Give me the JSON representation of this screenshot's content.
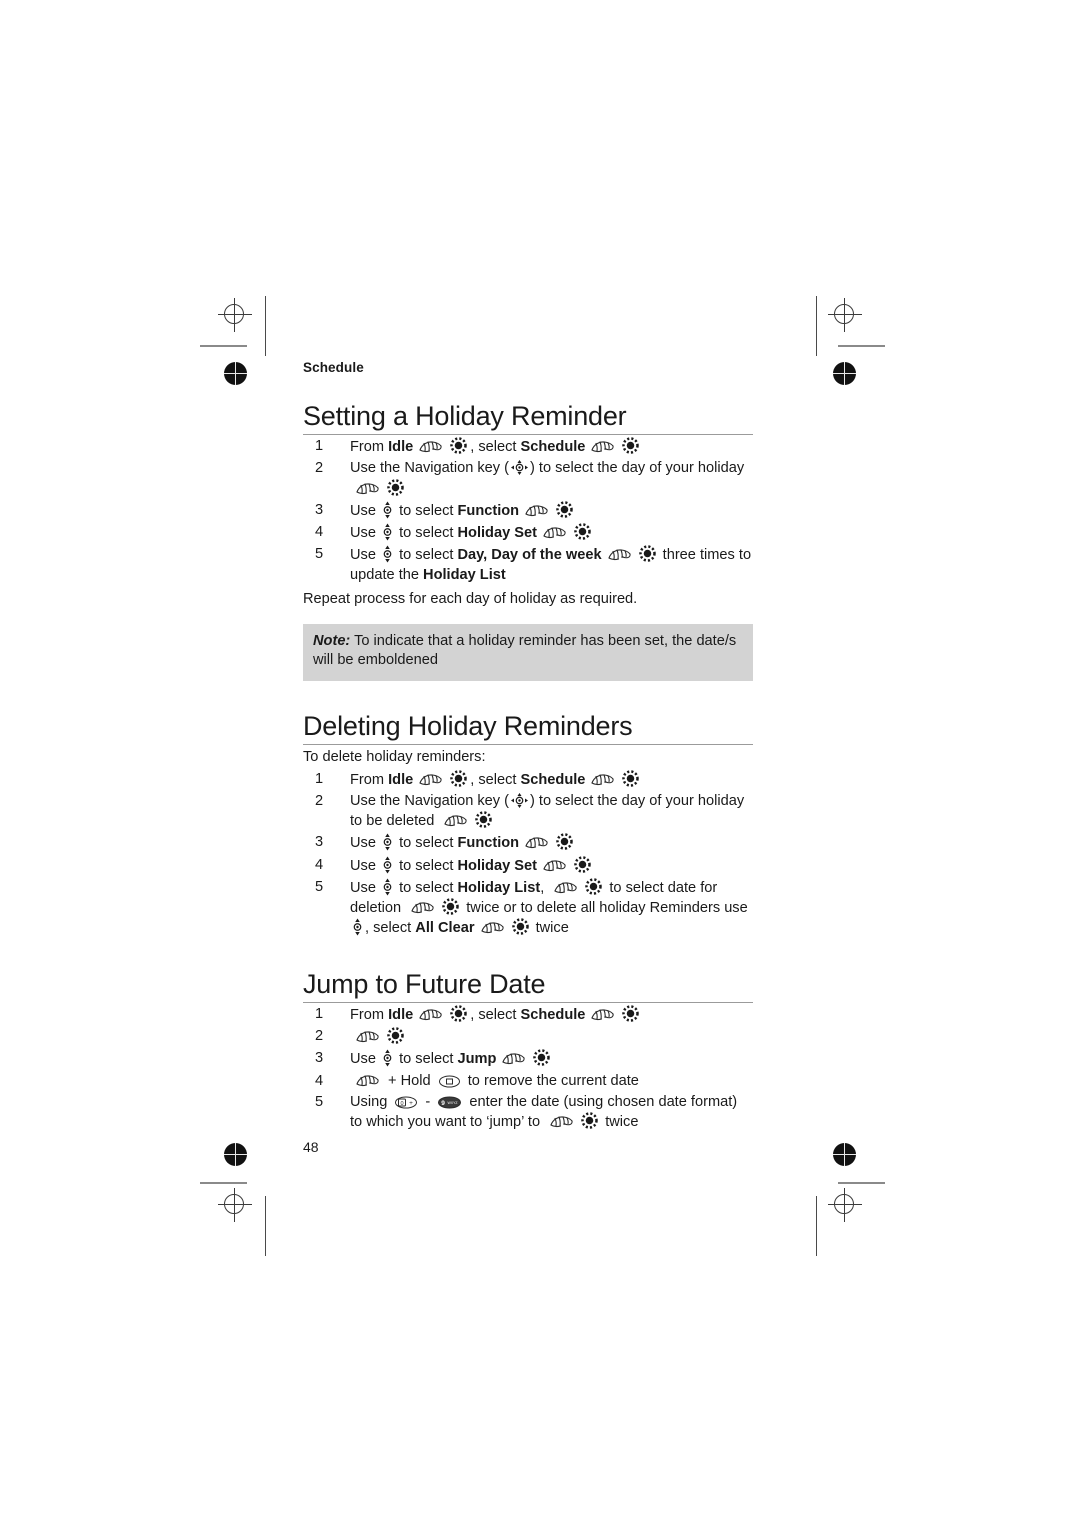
{
  "page": {
    "running_head": "Schedule",
    "page_number": "48"
  },
  "icons": {
    "press": "press-hand-icon",
    "ok": "select-ok-key-icon",
    "nav": "navigation-key-icon",
    "updown": "up-down-key-icon",
    "clear": "clear-key-icon",
    "key0": "keypad-0-plus-icon",
    "key9": "keypad-9-wxyz-icon"
  },
  "sections": [
    {
      "title": "Setting a Holiday Reminder",
      "steps": [
        {
          "num": "1",
          "parts": [
            {
              "t": "text",
              "v": "From "
            },
            {
              "t": "bold",
              "v": "Idle"
            },
            {
              "t": "icon",
              "v": "press"
            },
            {
              "t": "icon",
              "v": "ok"
            },
            {
              "t": "text",
              "v": ", select "
            },
            {
              "t": "bold",
              "v": "Schedule"
            },
            {
              "t": "icon",
              "v": "press"
            },
            {
              "t": "icon",
              "v": "ok"
            }
          ]
        },
        {
          "num": "2",
          "parts": [
            {
              "t": "text",
              "v": "Use the Navigation key ("
            },
            {
              "t": "icon",
              "v": "nav"
            },
            {
              "t": "text",
              "v": ") to select the day of your holiday "
            },
            {
              "t": "icon",
              "v": "press"
            },
            {
              "t": "icon",
              "v": "ok"
            }
          ]
        },
        {
          "num": "3",
          "parts": [
            {
              "t": "text",
              "v": "Use "
            },
            {
              "t": "icon",
              "v": "updown"
            },
            {
              "t": "text",
              "v": " to select "
            },
            {
              "t": "bold",
              "v": "Function"
            },
            {
              "t": "icon",
              "v": "press"
            },
            {
              "t": "icon",
              "v": "ok"
            }
          ]
        },
        {
          "num": "4",
          "parts": [
            {
              "t": "text",
              "v": "Use "
            },
            {
              "t": "icon",
              "v": "updown"
            },
            {
              "t": "text",
              "v": " to select "
            },
            {
              "t": "bold",
              "v": "Holiday Set"
            },
            {
              "t": "icon",
              "v": "press"
            },
            {
              "t": "icon",
              "v": "ok"
            }
          ]
        },
        {
          "num": "5",
          "parts": [
            {
              "t": "text",
              "v": "Use "
            },
            {
              "t": "icon",
              "v": "updown"
            },
            {
              "t": "text",
              "v": " to select "
            },
            {
              "t": "bold",
              "v": "Day, Day of the week"
            },
            {
              "t": "icon",
              "v": "press"
            },
            {
              "t": "icon",
              "v": "ok"
            },
            {
              "t": "text",
              "v": " three times to update the "
            },
            {
              "t": "bold",
              "v": "Holiday List"
            }
          ]
        }
      ],
      "after_text": "Repeat process for each day of holiday as required.",
      "note": {
        "label": "Note:",
        "text": " To indicate that a holiday reminder has been set, the date/s will be emboldened"
      }
    },
    {
      "title": "Deleting Holiday Reminders",
      "intro": "To delete holiday reminders:",
      "steps": [
        {
          "num": "1",
          "parts": [
            {
              "t": "text",
              "v": "From "
            },
            {
              "t": "bold",
              "v": "Idle"
            },
            {
              "t": "icon",
              "v": "press"
            },
            {
              "t": "icon",
              "v": "ok"
            },
            {
              "t": "text",
              "v": ", select "
            },
            {
              "t": "bold",
              "v": "Schedule"
            },
            {
              "t": "icon",
              "v": "press"
            },
            {
              "t": "icon",
              "v": "ok"
            }
          ]
        },
        {
          "num": "2",
          "parts": [
            {
              "t": "text",
              "v": "Use the Navigation key ("
            },
            {
              "t": "icon",
              "v": "nav"
            },
            {
              "t": "text",
              "v": ") to select the day of your holiday to be deleted "
            },
            {
              "t": "icon",
              "v": "press"
            },
            {
              "t": "icon",
              "v": "ok"
            }
          ]
        },
        {
          "num": "3",
          "parts": [
            {
              "t": "text",
              "v": "Use "
            },
            {
              "t": "icon",
              "v": "updown"
            },
            {
              "t": "text",
              "v": " to select "
            },
            {
              "t": "bold",
              "v": "Function"
            },
            {
              "t": "icon",
              "v": "press"
            },
            {
              "t": "icon",
              "v": "ok"
            }
          ]
        },
        {
          "num": "4",
          "parts": [
            {
              "t": "text",
              "v": "Use "
            },
            {
              "t": "icon",
              "v": "updown"
            },
            {
              "t": "text",
              "v": " to select "
            },
            {
              "t": "bold",
              "v": "Holiday Set"
            },
            {
              "t": "icon",
              "v": "press"
            },
            {
              "t": "icon",
              "v": "ok"
            }
          ]
        },
        {
          "num": "5",
          "parts": [
            {
              "t": "text",
              "v": "Use "
            },
            {
              "t": "icon",
              "v": "updown"
            },
            {
              "t": "text",
              "v": " to select "
            },
            {
              "t": "bold",
              "v": "Holiday List"
            },
            {
              "t": "text",
              "v": ", "
            },
            {
              "t": "icon",
              "v": "press"
            },
            {
              "t": "icon",
              "v": "ok"
            },
            {
              "t": "text",
              "v": " to select date for deletion "
            },
            {
              "t": "icon",
              "v": "press"
            },
            {
              "t": "icon",
              "v": "ok"
            },
            {
              "t": "text",
              "v": " twice or to delete all holiday Reminders use "
            },
            {
              "t": "icon",
              "v": "updown"
            },
            {
              "t": "text",
              "v": ", select "
            },
            {
              "t": "bold",
              "v": "All Clear"
            },
            {
              "t": "icon",
              "v": "press"
            },
            {
              "t": "icon",
              "v": "ok"
            },
            {
              "t": "text",
              "v": " twice"
            }
          ]
        }
      ]
    },
    {
      "title": "Jump to Future Date",
      "steps": [
        {
          "num": "1",
          "parts": [
            {
              "t": "text",
              "v": "From "
            },
            {
              "t": "bold",
              "v": "Idle"
            },
            {
              "t": "icon",
              "v": "press"
            },
            {
              "t": "icon",
              "v": "ok"
            },
            {
              "t": "text",
              "v": ", select "
            },
            {
              "t": "bold",
              "v": "Schedule"
            },
            {
              "t": "icon",
              "v": "press"
            },
            {
              "t": "icon",
              "v": "ok"
            }
          ]
        },
        {
          "num": "2",
          "parts": [
            {
              "t": "icon",
              "v": "press"
            },
            {
              "t": "icon",
              "v": "ok"
            }
          ]
        },
        {
          "num": "3",
          "parts": [
            {
              "t": "text",
              "v": "Use "
            },
            {
              "t": "icon",
              "v": "updown"
            },
            {
              "t": "text",
              "v": " to select "
            },
            {
              "t": "bold",
              "v": "Jump"
            },
            {
              "t": "icon",
              "v": "press"
            },
            {
              "t": "icon",
              "v": "ok"
            }
          ]
        },
        {
          "num": "4",
          "parts": [
            {
              "t": "icon",
              "v": "press"
            },
            {
              "t": "text",
              "v": " + Hold "
            },
            {
              "t": "icon",
              "v": "clear"
            },
            {
              "t": "text",
              "v": " to remove the current date"
            }
          ]
        },
        {
          "num": "5",
          "parts": [
            {
              "t": "text",
              "v": "Using "
            },
            {
              "t": "icon",
              "v": "key0"
            },
            {
              "t": "text",
              "v": " - "
            },
            {
              "t": "icon",
              "v": "key9"
            },
            {
              "t": "text",
              "v": " enter the date (using chosen date format) to which  you want to ‘jump’ to "
            },
            {
              "t": "icon",
              "v": "press"
            },
            {
              "t": "icon",
              "v": "ok"
            },
            {
              "t": "text",
              "v": " twice"
            }
          ]
        }
      ]
    }
  ]
}
